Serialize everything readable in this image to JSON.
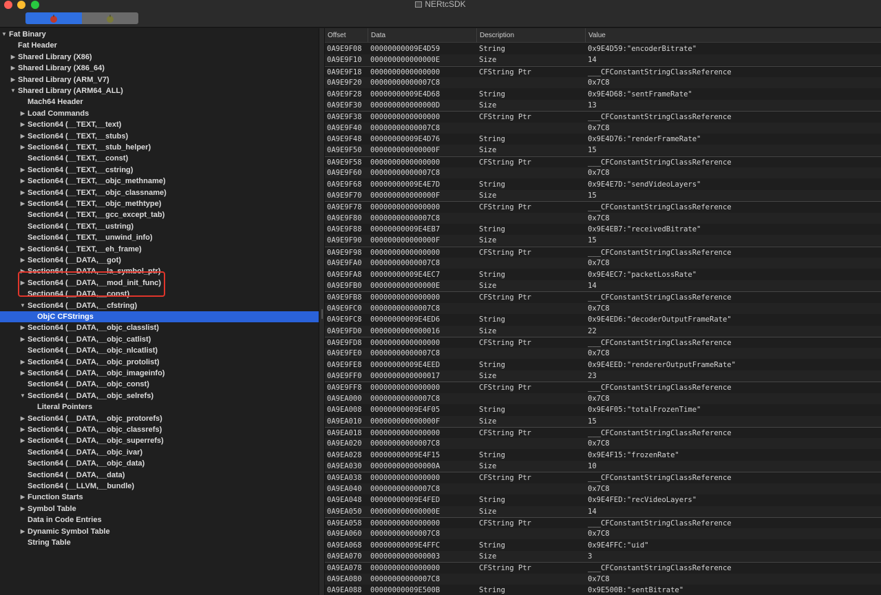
{
  "window": {
    "title": "NERtcSDK"
  },
  "toolbar": {
    "segments": [
      "ppc-icon",
      "intel-icon"
    ],
    "active_index": 0
  },
  "tree": [
    {
      "label": "Fat Binary",
      "indent": 0,
      "disclosure": "open"
    },
    {
      "label": "Fat Header",
      "indent": 1,
      "disclosure": "none"
    },
    {
      "label": "Shared Library  (X86)",
      "indent": 1,
      "disclosure": "closed"
    },
    {
      "label": "Shared Library  (X86_64)",
      "indent": 1,
      "disclosure": "closed"
    },
    {
      "label": "Shared Library  (ARM_V7)",
      "indent": 1,
      "disclosure": "closed"
    },
    {
      "label": "Shared Library  (ARM64_ALL)",
      "indent": 1,
      "disclosure": "open"
    },
    {
      "label": "Mach64 Header",
      "indent": 2,
      "disclosure": "none"
    },
    {
      "label": "Load Commands",
      "indent": 2,
      "disclosure": "closed"
    },
    {
      "label": "Section64 (__TEXT,__text)",
      "indent": 2,
      "disclosure": "closed"
    },
    {
      "label": "Section64 (__TEXT,__stubs)",
      "indent": 2,
      "disclosure": "closed"
    },
    {
      "label": "Section64 (__TEXT,__stub_helper)",
      "indent": 2,
      "disclosure": "closed"
    },
    {
      "label": "Section64 (__TEXT,__const)",
      "indent": 2,
      "disclosure": "none"
    },
    {
      "label": "Section64 (__TEXT,__cstring)",
      "indent": 2,
      "disclosure": "closed"
    },
    {
      "label": "Section64 (__TEXT,__objc_methname)",
      "indent": 2,
      "disclosure": "closed"
    },
    {
      "label": "Section64 (__TEXT,__objc_classname)",
      "indent": 2,
      "disclosure": "closed"
    },
    {
      "label": "Section64 (__TEXT,__objc_methtype)",
      "indent": 2,
      "disclosure": "closed"
    },
    {
      "label": "Section64 (__TEXT,__gcc_except_tab)",
      "indent": 2,
      "disclosure": "none"
    },
    {
      "label": "Section64 (__TEXT,__ustring)",
      "indent": 2,
      "disclosure": "none"
    },
    {
      "label": "Section64 (__TEXT,__unwind_info)",
      "indent": 2,
      "disclosure": "none"
    },
    {
      "label": "Section64 (__TEXT,__eh_frame)",
      "indent": 2,
      "disclosure": "closed"
    },
    {
      "label": "Section64 (__DATA,__got)",
      "indent": 2,
      "disclosure": "closed"
    },
    {
      "label": "Section64 (__DATA,__la_symbol_ptr)",
      "indent": 2,
      "disclosure": "closed"
    },
    {
      "label": "Section64 (__DATA,__mod_init_func)",
      "indent": 2,
      "disclosure": "closed"
    },
    {
      "label": "Section64 (__DATA,__const)",
      "indent": 2,
      "disclosure": "none"
    },
    {
      "label": "Section64 (__DATA,__cfstring)",
      "indent": 2,
      "disclosure": "open"
    },
    {
      "label": "ObjC CFStrings",
      "indent": 3,
      "disclosure": "none",
      "selected": true
    },
    {
      "label": "Section64 (__DATA,__objc_classlist)",
      "indent": 2,
      "disclosure": "closed"
    },
    {
      "label": "Section64 (__DATA,__objc_catlist)",
      "indent": 2,
      "disclosure": "closed"
    },
    {
      "label": "Section64 (__DATA,__objc_nlcatlist)",
      "indent": 2,
      "disclosure": "none"
    },
    {
      "label": "Section64 (__DATA,__objc_protolist)",
      "indent": 2,
      "disclosure": "closed"
    },
    {
      "label": "Section64 (__DATA,__objc_imageinfo)",
      "indent": 2,
      "disclosure": "closed"
    },
    {
      "label": "Section64 (__DATA,__objc_const)",
      "indent": 2,
      "disclosure": "none"
    },
    {
      "label": "Section64 (__DATA,__objc_selrefs)",
      "indent": 2,
      "disclosure": "open"
    },
    {
      "label": "Literal Pointers",
      "indent": 3,
      "disclosure": "none"
    },
    {
      "label": "Section64 (__DATA,__objc_protorefs)",
      "indent": 2,
      "disclosure": "closed"
    },
    {
      "label": "Section64 (__DATA,__objc_classrefs)",
      "indent": 2,
      "disclosure": "closed"
    },
    {
      "label": "Section64 (__DATA,__objc_superrefs)",
      "indent": 2,
      "disclosure": "closed"
    },
    {
      "label": "Section64 (__DATA,__objc_ivar)",
      "indent": 2,
      "disclosure": "none"
    },
    {
      "label": "Section64 (__DATA,__objc_data)",
      "indent": 2,
      "disclosure": "none"
    },
    {
      "label": "Section64 (__DATA,__data)",
      "indent": 2,
      "disclosure": "none"
    },
    {
      "label": "Section64 (__LLVM,__bundle)",
      "indent": 2,
      "disclosure": "none"
    },
    {
      "label": "Function Starts",
      "indent": 2,
      "disclosure": "closed"
    },
    {
      "label": "Symbol Table",
      "indent": 2,
      "disclosure": "closed"
    },
    {
      "label": "Data in Code Entries",
      "indent": 2,
      "disclosure": "none"
    },
    {
      "label": "Dynamic Symbol Table",
      "indent": 2,
      "disclosure": "closed"
    },
    {
      "label": "String Table",
      "indent": 2,
      "disclosure": "none"
    }
  ],
  "table": {
    "columns": [
      "Offset",
      "Data",
      "Description",
      "Value"
    ],
    "rows": [
      [
        "0A9E9F08",
        "00000000009E4D59",
        "String",
        "0x9E4D59:\"encoderBitrate\""
      ],
      [
        "0A9E9F10",
        "000000000000000E",
        "Size",
        "14"
      ],
      [
        "0A9E9F18",
        "0000000000000000",
        "CFString Ptr",
        "___CFConstantStringClassReference"
      ],
      [
        "0A9E9F20",
        "00000000000007C8",
        "",
        "0x7C8"
      ],
      [
        "0A9E9F28",
        "00000000009E4D68",
        "String",
        "0x9E4D68:\"sentFrameRate\""
      ],
      [
        "0A9E9F30",
        "000000000000000D",
        "Size",
        "13"
      ],
      [
        "0A9E9F38",
        "0000000000000000",
        "CFString Ptr",
        "___CFConstantStringClassReference"
      ],
      [
        "0A9E9F40",
        "00000000000007C8",
        "",
        "0x7C8"
      ],
      [
        "0A9E9F48",
        "00000000009E4D76",
        "String",
        "0x9E4D76:\"renderFrameRate\""
      ],
      [
        "0A9E9F50",
        "000000000000000F",
        "Size",
        "15"
      ],
      [
        "0A9E9F58",
        "0000000000000000",
        "CFString Ptr",
        "___CFConstantStringClassReference"
      ],
      [
        "0A9E9F60",
        "00000000000007C8",
        "",
        "0x7C8"
      ],
      [
        "0A9E9F68",
        "00000000009E4E7D",
        "String",
        "0x9E4E7D:\"sendVideoLayers\""
      ],
      [
        "0A9E9F70",
        "000000000000000F",
        "Size",
        "15"
      ],
      [
        "0A9E9F78",
        "0000000000000000",
        "CFString Ptr",
        "___CFConstantStringClassReference"
      ],
      [
        "0A9E9F80",
        "00000000000007C8",
        "",
        "0x7C8"
      ],
      [
        "0A9E9F88",
        "00000000009E4EB7",
        "String",
        "0x9E4EB7:\"receivedBitrate\""
      ],
      [
        "0A9E9F90",
        "000000000000000F",
        "Size",
        "15"
      ],
      [
        "0A9E9F98",
        "0000000000000000",
        "CFString Ptr",
        "___CFConstantStringClassReference"
      ],
      [
        "0A9E9FA0",
        "00000000000007C8",
        "",
        "0x7C8"
      ],
      [
        "0A9E9FA8",
        "00000000009E4EC7",
        "String",
        "0x9E4EC7:\"packetLossRate\""
      ],
      [
        "0A9E9FB0",
        "000000000000000E",
        "Size",
        "14"
      ],
      [
        "0A9E9FB8",
        "0000000000000000",
        "CFString Ptr",
        "___CFConstantStringClassReference"
      ],
      [
        "0A9E9FC0",
        "00000000000007C8",
        "",
        "0x7C8"
      ],
      [
        "0A9E9FC8",
        "00000000009E4ED6",
        "String",
        "0x9E4ED6:\"decoderOutputFrameRate\""
      ],
      [
        "0A9E9FD0",
        "0000000000000016",
        "Size",
        "22"
      ],
      [
        "0A9E9FD8",
        "0000000000000000",
        "CFString Ptr",
        "___CFConstantStringClassReference"
      ],
      [
        "0A9E9FE0",
        "00000000000007C8",
        "",
        "0x7C8"
      ],
      [
        "0A9E9FE8",
        "00000000009E4EED",
        "String",
        "0x9E4EED:\"rendererOutputFrameRate\""
      ],
      [
        "0A9E9FF0",
        "0000000000000017",
        "Size",
        "23"
      ],
      [
        "0A9E9FF8",
        "0000000000000000",
        "CFString Ptr",
        "___CFConstantStringClassReference"
      ],
      [
        "0A9EA000",
        "00000000000007C8",
        "",
        "0x7C8"
      ],
      [
        "0A9EA008",
        "00000000009E4F05",
        "String",
        "0x9E4F05:\"totalFrozenTime\""
      ],
      [
        "0A9EA010",
        "000000000000000F",
        "Size",
        "15"
      ],
      [
        "0A9EA018",
        "0000000000000000",
        "CFString Ptr",
        "___CFConstantStringClassReference"
      ],
      [
        "0A9EA020",
        "00000000000007C8",
        "",
        "0x7C8"
      ],
      [
        "0A9EA028",
        "00000000009E4F15",
        "String",
        "0x9E4F15:\"frozenRate\""
      ],
      [
        "0A9EA030",
        "000000000000000A",
        "Size",
        "10"
      ],
      [
        "0A9EA038",
        "0000000000000000",
        "CFString Ptr",
        "___CFConstantStringClassReference"
      ],
      [
        "0A9EA040",
        "00000000000007C8",
        "",
        "0x7C8"
      ],
      [
        "0A9EA048",
        "00000000009E4FED",
        "String",
        "0x9E4FED:\"recVideoLayers\""
      ],
      [
        "0A9EA050",
        "000000000000000E",
        "Size",
        "14"
      ],
      [
        "0A9EA058",
        "0000000000000000",
        "CFString Ptr",
        "___CFConstantStringClassReference"
      ],
      [
        "0A9EA060",
        "00000000000007C8",
        "",
        "0x7C8"
      ],
      [
        "0A9EA068",
        "00000000009E4FFC",
        "String",
        "0x9E4FFC:\"uid\""
      ],
      [
        "0A9EA070",
        "0000000000000003",
        "Size",
        "3"
      ],
      [
        "0A9EA078",
        "0000000000000000",
        "CFString Ptr",
        "___CFConstantStringClassReference"
      ],
      [
        "0A9EA080",
        "00000000000007C8",
        "",
        "0x7C8"
      ],
      [
        "0A9EA088",
        "00000000009E500B",
        "String",
        "0x9E500B:\"sentBitrate\""
      ]
    ]
  },
  "colors": {
    "selection": "#2a62d9",
    "highlight_box": "#e0352b",
    "segment_active": "#2f6fe0"
  }
}
